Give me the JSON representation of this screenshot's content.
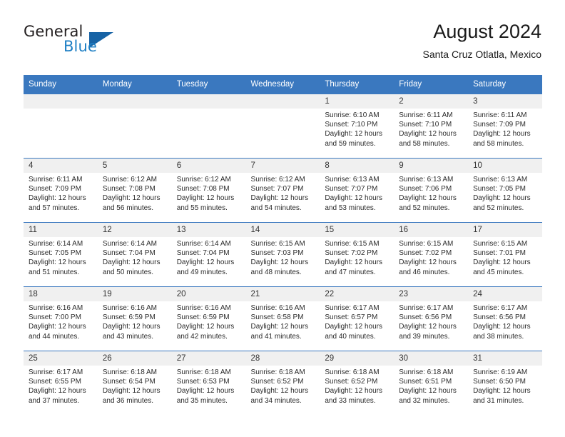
{
  "brand": {
    "name_part1": "General",
    "name_part2": "Blue"
  },
  "header": {
    "title": "August 2024",
    "subtitle": "Santa Cruz Otlatla, Mexico"
  },
  "weekday_headers": [
    "Sunday",
    "Monday",
    "Tuesday",
    "Wednesday",
    "Thursday",
    "Friday",
    "Saturday"
  ],
  "colors": {
    "header_blue": "#3a78bf",
    "brand_blue": "#1e7fc4",
    "daynum_band": "#f0f0f0"
  },
  "weeks": [
    [
      {
        "day": "",
        "sunrise": "",
        "sunset": "",
        "daylight1": "",
        "daylight2": ""
      },
      {
        "day": "",
        "sunrise": "",
        "sunset": "",
        "daylight1": "",
        "daylight2": ""
      },
      {
        "day": "",
        "sunrise": "",
        "sunset": "",
        "daylight1": "",
        "daylight2": ""
      },
      {
        "day": "",
        "sunrise": "",
        "sunset": "",
        "daylight1": "",
        "daylight2": ""
      },
      {
        "day": "1",
        "sunrise": "Sunrise: 6:10 AM",
        "sunset": "Sunset: 7:10 PM",
        "daylight1": "Daylight: 12 hours",
        "daylight2": "and 59 minutes."
      },
      {
        "day": "2",
        "sunrise": "Sunrise: 6:11 AM",
        "sunset": "Sunset: 7:10 PM",
        "daylight1": "Daylight: 12 hours",
        "daylight2": "and 58 minutes."
      },
      {
        "day": "3",
        "sunrise": "Sunrise: 6:11 AM",
        "sunset": "Sunset: 7:09 PM",
        "daylight1": "Daylight: 12 hours",
        "daylight2": "and 58 minutes."
      }
    ],
    [
      {
        "day": "4",
        "sunrise": "Sunrise: 6:11 AM",
        "sunset": "Sunset: 7:09 PM",
        "daylight1": "Daylight: 12 hours",
        "daylight2": "and 57 minutes."
      },
      {
        "day": "5",
        "sunrise": "Sunrise: 6:12 AM",
        "sunset": "Sunset: 7:08 PM",
        "daylight1": "Daylight: 12 hours",
        "daylight2": "and 56 minutes."
      },
      {
        "day": "6",
        "sunrise": "Sunrise: 6:12 AM",
        "sunset": "Sunset: 7:08 PM",
        "daylight1": "Daylight: 12 hours",
        "daylight2": "and 55 minutes."
      },
      {
        "day": "7",
        "sunrise": "Sunrise: 6:12 AM",
        "sunset": "Sunset: 7:07 PM",
        "daylight1": "Daylight: 12 hours",
        "daylight2": "and 54 minutes."
      },
      {
        "day": "8",
        "sunrise": "Sunrise: 6:13 AM",
        "sunset": "Sunset: 7:07 PM",
        "daylight1": "Daylight: 12 hours",
        "daylight2": "and 53 minutes."
      },
      {
        "day": "9",
        "sunrise": "Sunrise: 6:13 AM",
        "sunset": "Sunset: 7:06 PM",
        "daylight1": "Daylight: 12 hours",
        "daylight2": "and 52 minutes."
      },
      {
        "day": "10",
        "sunrise": "Sunrise: 6:13 AM",
        "sunset": "Sunset: 7:05 PM",
        "daylight1": "Daylight: 12 hours",
        "daylight2": "and 52 minutes."
      }
    ],
    [
      {
        "day": "11",
        "sunrise": "Sunrise: 6:14 AM",
        "sunset": "Sunset: 7:05 PM",
        "daylight1": "Daylight: 12 hours",
        "daylight2": "and 51 minutes."
      },
      {
        "day": "12",
        "sunrise": "Sunrise: 6:14 AM",
        "sunset": "Sunset: 7:04 PM",
        "daylight1": "Daylight: 12 hours",
        "daylight2": "and 50 minutes."
      },
      {
        "day": "13",
        "sunrise": "Sunrise: 6:14 AM",
        "sunset": "Sunset: 7:04 PM",
        "daylight1": "Daylight: 12 hours",
        "daylight2": "and 49 minutes."
      },
      {
        "day": "14",
        "sunrise": "Sunrise: 6:15 AM",
        "sunset": "Sunset: 7:03 PM",
        "daylight1": "Daylight: 12 hours",
        "daylight2": "and 48 minutes."
      },
      {
        "day": "15",
        "sunrise": "Sunrise: 6:15 AM",
        "sunset": "Sunset: 7:02 PM",
        "daylight1": "Daylight: 12 hours",
        "daylight2": "and 47 minutes."
      },
      {
        "day": "16",
        "sunrise": "Sunrise: 6:15 AM",
        "sunset": "Sunset: 7:02 PM",
        "daylight1": "Daylight: 12 hours",
        "daylight2": "and 46 minutes."
      },
      {
        "day": "17",
        "sunrise": "Sunrise: 6:15 AM",
        "sunset": "Sunset: 7:01 PM",
        "daylight1": "Daylight: 12 hours",
        "daylight2": "and 45 minutes."
      }
    ],
    [
      {
        "day": "18",
        "sunrise": "Sunrise: 6:16 AM",
        "sunset": "Sunset: 7:00 PM",
        "daylight1": "Daylight: 12 hours",
        "daylight2": "and 44 minutes."
      },
      {
        "day": "19",
        "sunrise": "Sunrise: 6:16 AM",
        "sunset": "Sunset: 6:59 PM",
        "daylight1": "Daylight: 12 hours",
        "daylight2": "and 43 minutes."
      },
      {
        "day": "20",
        "sunrise": "Sunrise: 6:16 AM",
        "sunset": "Sunset: 6:59 PM",
        "daylight1": "Daylight: 12 hours",
        "daylight2": "and 42 minutes."
      },
      {
        "day": "21",
        "sunrise": "Sunrise: 6:16 AM",
        "sunset": "Sunset: 6:58 PM",
        "daylight1": "Daylight: 12 hours",
        "daylight2": "and 41 minutes."
      },
      {
        "day": "22",
        "sunrise": "Sunrise: 6:17 AM",
        "sunset": "Sunset: 6:57 PM",
        "daylight1": "Daylight: 12 hours",
        "daylight2": "and 40 minutes."
      },
      {
        "day": "23",
        "sunrise": "Sunrise: 6:17 AM",
        "sunset": "Sunset: 6:56 PM",
        "daylight1": "Daylight: 12 hours",
        "daylight2": "and 39 minutes."
      },
      {
        "day": "24",
        "sunrise": "Sunrise: 6:17 AM",
        "sunset": "Sunset: 6:56 PM",
        "daylight1": "Daylight: 12 hours",
        "daylight2": "and 38 minutes."
      }
    ],
    [
      {
        "day": "25",
        "sunrise": "Sunrise: 6:17 AM",
        "sunset": "Sunset: 6:55 PM",
        "daylight1": "Daylight: 12 hours",
        "daylight2": "and 37 minutes."
      },
      {
        "day": "26",
        "sunrise": "Sunrise: 6:18 AM",
        "sunset": "Sunset: 6:54 PM",
        "daylight1": "Daylight: 12 hours",
        "daylight2": "and 36 minutes."
      },
      {
        "day": "27",
        "sunrise": "Sunrise: 6:18 AM",
        "sunset": "Sunset: 6:53 PM",
        "daylight1": "Daylight: 12 hours",
        "daylight2": "and 35 minutes."
      },
      {
        "day": "28",
        "sunrise": "Sunrise: 6:18 AM",
        "sunset": "Sunset: 6:52 PM",
        "daylight1": "Daylight: 12 hours",
        "daylight2": "and 34 minutes."
      },
      {
        "day": "29",
        "sunrise": "Sunrise: 6:18 AM",
        "sunset": "Sunset: 6:52 PM",
        "daylight1": "Daylight: 12 hours",
        "daylight2": "and 33 minutes."
      },
      {
        "day": "30",
        "sunrise": "Sunrise: 6:18 AM",
        "sunset": "Sunset: 6:51 PM",
        "daylight1": "Daylight: 12 hours",
        "daylight2": "and 32 minutes."
      },
      {
        "day": "31",
        "sunrise": "Sunrise: 6:19 AM",
        "sunset": "Sunset: 6:50 PM",
        "daylight1": "Daylight: 12 hours",
        "daylight2": "and 31 minutes."
      }
    ]
  ]
}
